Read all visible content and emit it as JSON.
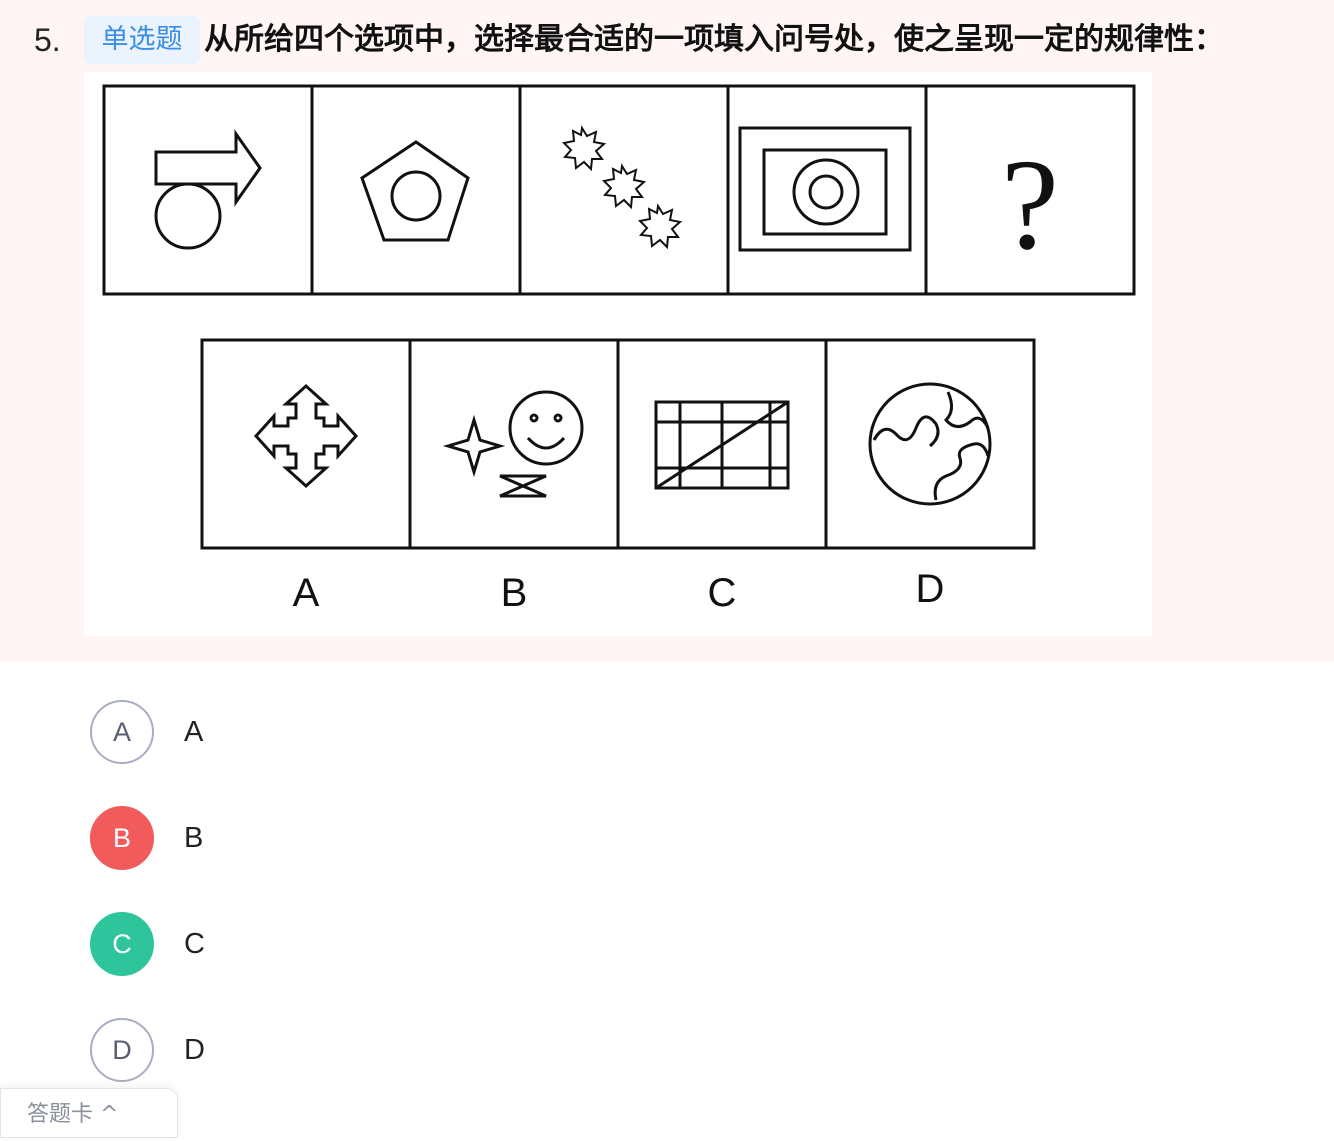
{
  "question": {
    "number": "5.",
    "type_tag": "单选题",
    "text": "从所给四个选项中，选择最合适的一项填入问号处，使之呈现一定的规律性："
  },
  "figure": {
    "question_mark": "?",
    "option_labels": [
      "A",
      "B",
      "C",
      "D"
    ]
  },
  "options": [
    {
      "letter": "A",
      "label": "A",
      "state": "normal"
    },
    {
      "letter": "B",
      "label": "B",
      "state": "wrong"
    },
    {
      "letter": "C",
      "label": "C",
      "state": "correct"
    },
    {
      "letter": "D",
      "label": "D",
      "state": "normal"
    }
  ],
  "answer_card": {
    "label": "答题卡 ^"
  },
  "colors": {
    "wrong": "#f25b5b",
    "correct": "#2ec59c",
    "tag_text": "#3a8ee6",
    "tag_bg": "#eaf3fe"
  }
}
